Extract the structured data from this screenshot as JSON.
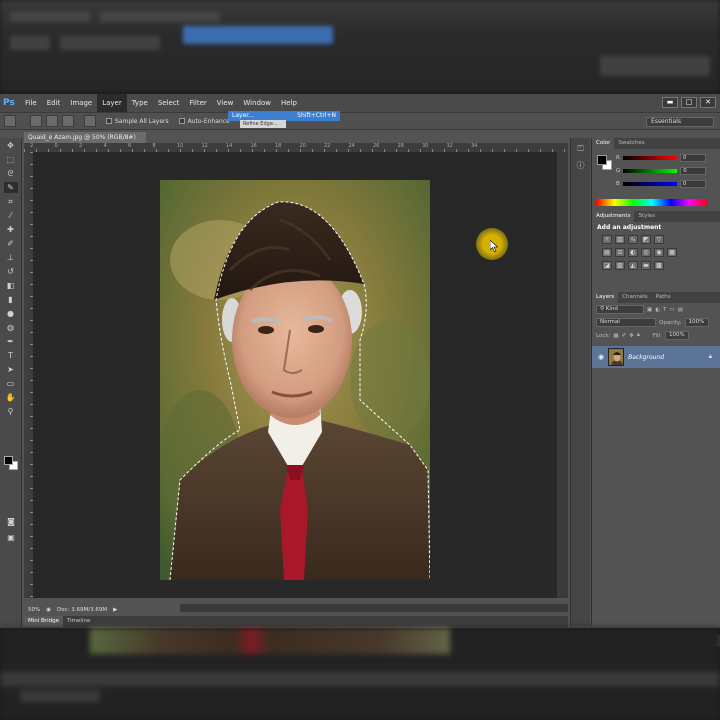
{
  "app": {
    "logo": "Ps",
    "menus": [
      "File",
      "Edit",
      "Image",
      "Layer",
      "Type",
      "Select",
      "Filter",
      "View",
      "Window",
      "Help"
    ],
    "active_menu": "Layer",
    "window_buttons": [
      "▬",
      "□",
      "✕"
    ]
  },
  "menu_dropdown": {
    "item_label": "Layer...",
    "shortcut": "Shift+Ctrl+N",
    "secondary_label": "Refine Edge..."
  },
  "options_bar": {
    "sample_all_layers": "Sample All Layers",
    "auto_enhance": "Auto-Enhance",
    "workspace": "Essentials"
  },
  "document": {
    "tab_title": "Quaid_e Azam.jpg @ 50% (RGB/8#)",
    "zoom": "50%",
    "doc_size": "Doc: 3.69M/3.69M",
    "ruler_labels": [
      "2",
      "0",
      "2",
      "4",
      "6",
      "8",
      "10",
      "12",
      "14",
      "16",
      "18",
      "20",
      "22",
      "24",
      "26",
      "28",
      "30",
      "32",
      "34"
    ]
  },
  "bottom_tabs": [
    "Mini Bridge",
    "Timeline"
  ],
  "panels": {
    "color_tabs": [
      "Color",
      "Swatches"
    ],
    "color_channels": [
      {
        "label": "R",
        "value": "0"
      },
      {
        "label": "G",
        "value": "0"
      },
      {
        "label": "B",
        "value": "0"
      }
    ],
    "adjustment_tabs": [
      "Adjustments",
      "Styles"
    ],
    "adjustment_title": "Add an adjustment",
    "layers_tabs": [
      "Layers",
      "Channels",
      "Paths"
    ],
    "kind_label": "Kind",
    "blend_mode": "Normal",
    "opacity_label": "Opacity:",
    "opacity_value": "100%",
    "lock_label": "Lock:",
    "fill_label": "Fill:",
    "fill_value": "100%",
    "layer_name": "Background"
  },
  "colors": {
    "accent_blue": "#3c7fd0",
    "layer_selected": "#5b7498",
    "cursor_highlight": "#d8b000"
  }
}
